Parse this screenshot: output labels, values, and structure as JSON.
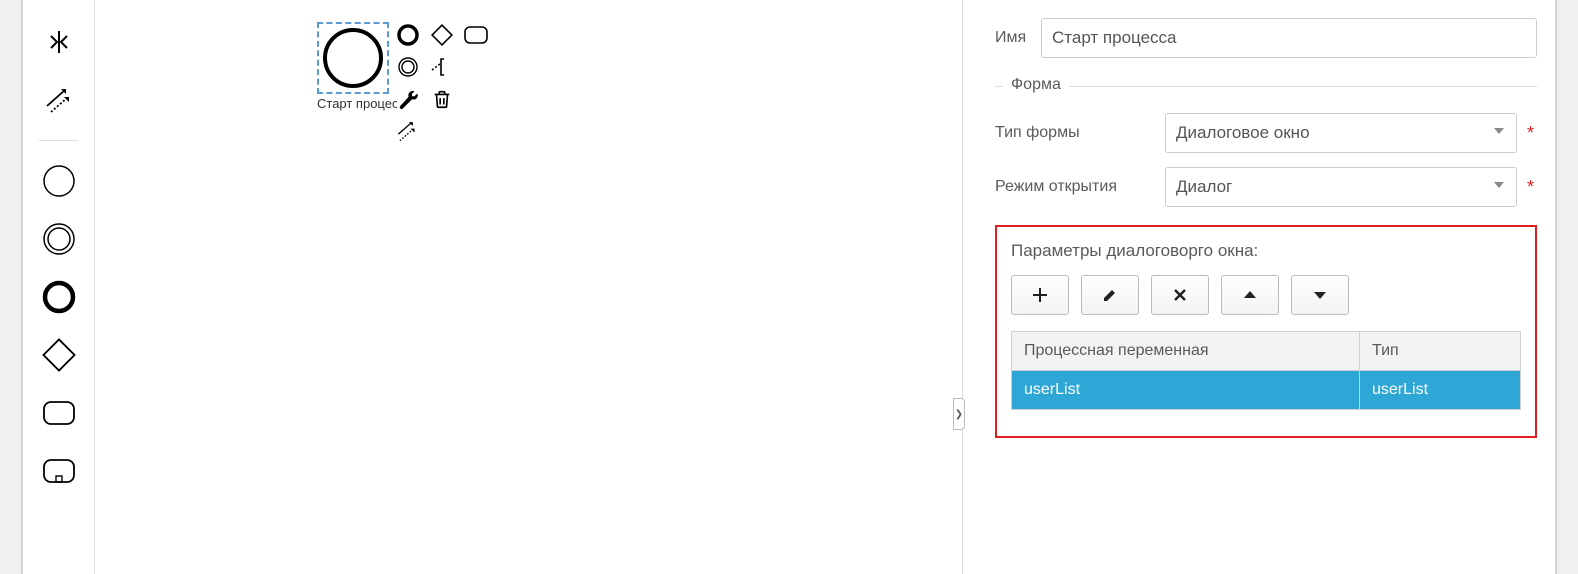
{
  "canvas": {
    "node": {
      "label": "Старт процес"
    }
  },
  "properties": {
    "name_label": "Имя",
    "name_value": "Старт процесса",
    "fieldset_form": "Форма",
    "form_type_label": "Тип формы",
    "form_type_value": "Диалоговое окно",
    "open_mode_label": "Режим открытия",
    "open_mode_value": "Диалог",
    "params_title": "Параметры диалоговорго окна:",
    "table": {
      "headers": {
        "variable": "Процессная переменная",
        "type": "Тип"
      },
      "rows": [
        {
          "variable": "userList",
          "type": "userList"
        }
      ]
    }
  }
}
